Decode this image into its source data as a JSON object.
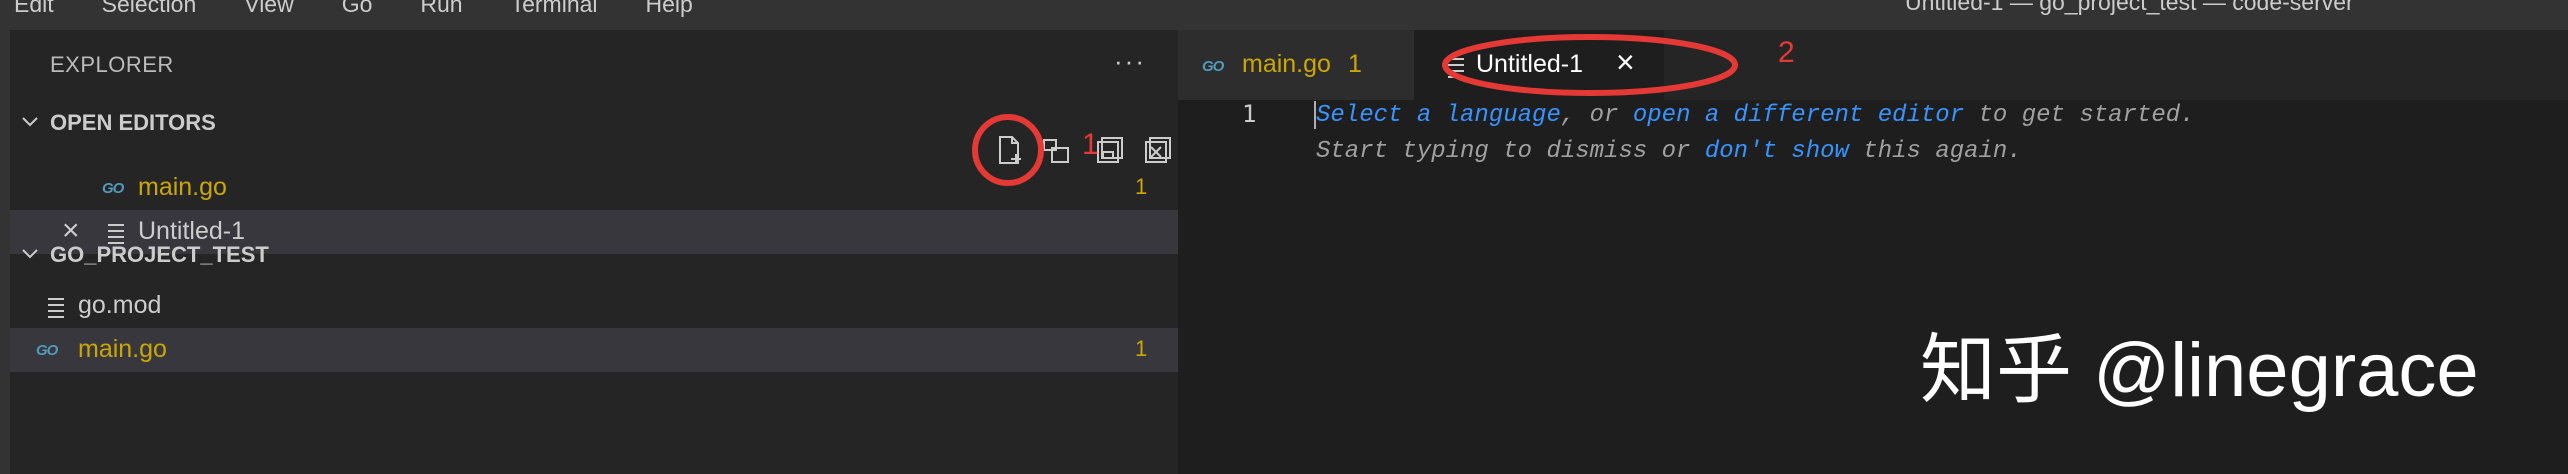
{
  "menubar": {
    "items": [
      "Edit",
      "Selection",
      "View",
      "Go",
      "Run",
      "Terminal",
      "Help"
    ],
    "window_title": "Untitled-1 — go_project_test — code-server"
  },
  "sidebar": {
    "title": "EXPLORER",
    "more": "···",
    "open_editors": {
      "title": "OPEN EDITORS",
      "items": [
        {
          "icon": "go-file-icon",
          "icon_text": "GO",
          "label": "main.go",
          "badge": "1",
          "color": "#cca700"
        },
        {
          "icon": "text-file-icon",
          "label": "Untitled-1",
          "close": "×",
          "color": "#cccccc"
        }
      ]
    },
    "project": {
      "title": "GO_PROJECT_TEST",
      "items": [
        {
          "icon": "text-file-icon",
          "label": "go.mod",
          "color": "#cccccc"
        },
        {
          "icon": "go-file-icon",
          "icon_text": "GO",
          "label": "main.go",
          "badge": "1",
          "color": "#cca700"
        }
      ]
    }
  },
  "editor": {
    "tabs": [
      {
        "icon": "go-file-icon",
        "icon_text": "GO",
        "label": "main.go",
        "badge": "1",
        "active": false
      },
      {
        "icon": "text-file-icon",
        "label": "Untitled-1",
        "close": "×",
        "active": true
      }
    ],
    "line_number": "1",
    "hint_line1": {
      "part1": "Select a language",
      "part2": ", or ",
      "part3": "open a different editor",
      "part4": " to get started."
    },
    "hint_line2": {
      "part1": "Start typing to dismiss or ",
      "part2": "don't show",
      "part3": " this again."
    }
  },
  "annotations": {
    "marker1": "1",
    "marker2": "2",
    "color": "#e53935"
  },
  "watermark": "知乎 @linegrace",
  "colors": {
    "accent_link": "#3794ff",
    "warning_badge": "#cca700",
    "go_icon": "#519aba"
  }
}
